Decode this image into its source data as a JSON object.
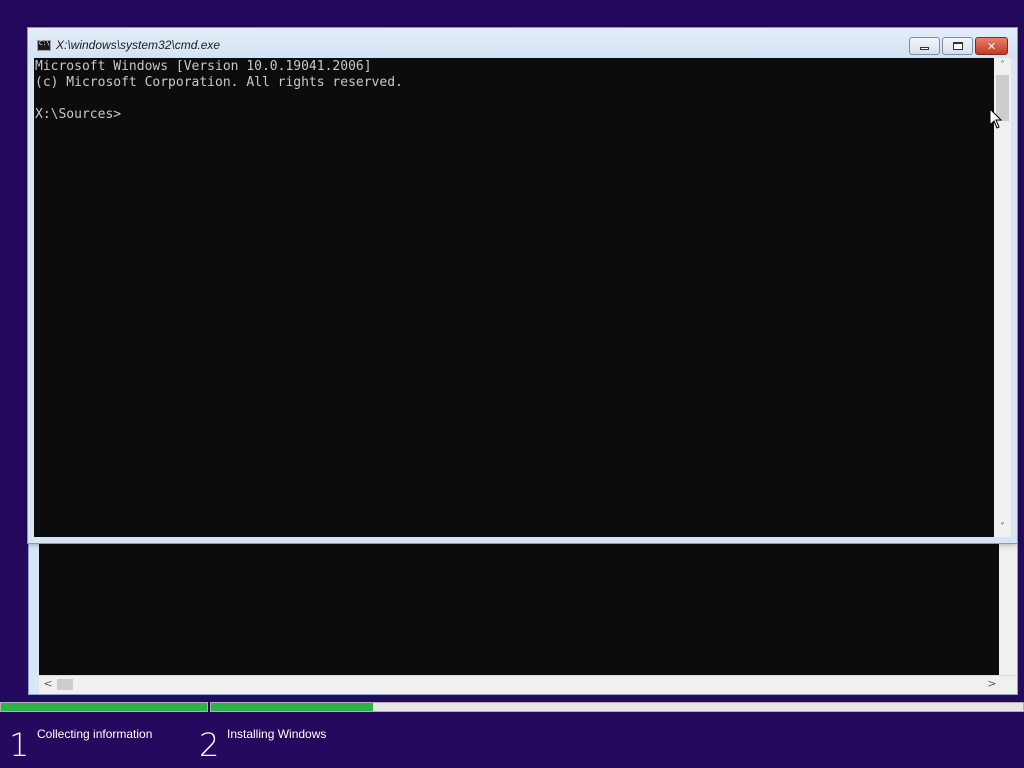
{
  "window": {
    "title": "X:\\windows\\system32\\cmd.exe",
    "icon": "cmd-icon"
  },
  "console": {
    "lines": [
      "Microsoft Windows [Version 10.0.19041.2006]",
      "(c) Microsoft Corporation. All rights reserved.",
      "",
      "X:\\Sources>"
    ]
  },
  "scroll_glyphs": {
    "up": "˄",
    "down": "˅",
    "left": "<",
    "right": ">"
  },
  "caption_buttons": {
    "close_glyph": "✕"
  },
  "installer": {
    "steps": [
      {
        "number": "1",
        "label": "Collecting information",
        "progress": 1.0
      },
      {
        "number": "2",
        "label": "Installing Windows",
        "progress": 0.2
      }
    ]
  },
  "colors": {
    "desktop": "#24095f",
    "console_bg": "#0c0c0c",
    "console_text": "#c8c8c8",
    "progress_fill": "#2bb548"
  }
}
